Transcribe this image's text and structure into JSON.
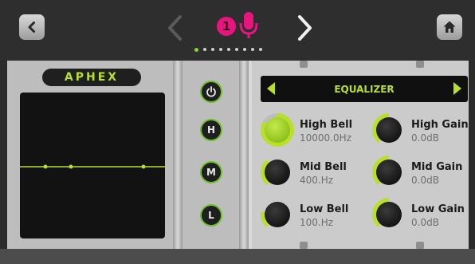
{
  "topbar": {
    "back_icon": "chevron-left-icon",
    "prev_icon": "chevron-left-icon",
    "next_icon": "chevron-right-icon",
    "home_icon": "home-icon",
    "channel_number": "1",
    "mic_icon": "microphone-icon",
    "page_count": 9,
    "active_page": 1
  },
  "plugin": {
    "logo_text": "APHEX"
  },
  "band_buttons": {
    "power_icon": "power-icon",
    "high": "H",
    "mid": "M",
    "low": "L"
  },
  "header": {
    "title": "EQUALIZER"
  },
  "knobs": {
    "high_bell": {
      "label": "High Bell",
      "value": "10000.0Hz"
    },
    "high_gain": {
      "label": "High Gain",
      "value": "0.0dB"
    },
    "mid_bell": {
      "label": "Mid Bell",
      "value": "400.Hz"
    },
    "mid_gain": {
      "label": "Mid Gain",
      "value": "0.0dB"
    },
    "low_bell": {
      "label": "Low Bell",
      "value": "100.Hz"
    },
    "low_gain": {
      "label": "Low Gain",
      "value": "0.0dB"
    }
  },
  "colors": {
    "accent": "#b8e02a",
    "channel_pink": "#e8157f"
  }
}
